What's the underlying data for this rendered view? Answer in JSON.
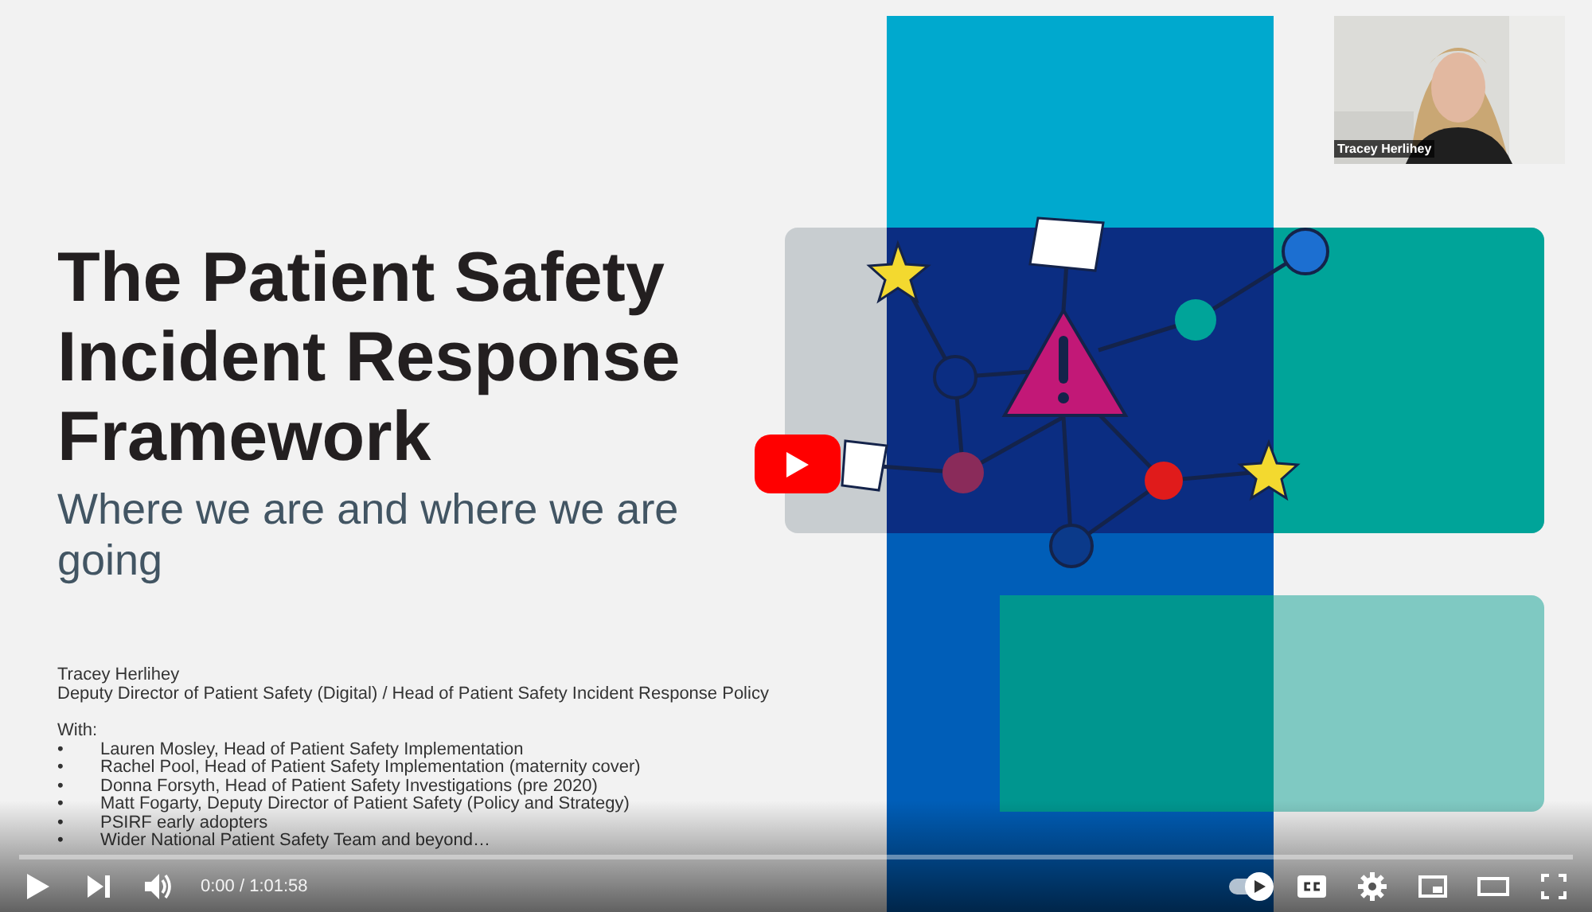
{
  "slide": {
    "title": "The Patient Safety Incident Response Framework",
    "subtitle": "Where we are and where we are going",
    "presenter": "Tracey Herlihey",
    "presenter_role": "Deputy Director of Patient Safety (Digital) / Head of Patient Safety Incident Response Policy",
    "with_label": "With:",
    "bullets": [
      {
        "marker": "•",
        "text": "Lauren Mosley, Head of Patient Safety Implementation"
      },
      {
        "marker": "•",
        "text": "Rachel Pool, Head of Patient Safety Implementation (maternity cover)"
      },
      {
        "marker": "•",
        "text": "Donna Forsyth, Head of Patient Safety Investigations (pre 2020)"
      },
      {
        "marker": "•",
        "text": "Matt Fogarty, Deputy Director of Patient Safety (Policy and Strategy)"
      },
      {
        "marker": "•",
        "text": "PSIRF early adopters"
      },
      {
        "marker": "•",
        "text": "Wider National Patient Safety Team and beyond…"
      }
    ]
  },
  "webcam": {
    "kind": "picture",
    "name_label": "Tracey Herlihey"
  },
  "player": {
    "time": "0:00 / 1:01:58",
    "autoplay": true
  }
}
